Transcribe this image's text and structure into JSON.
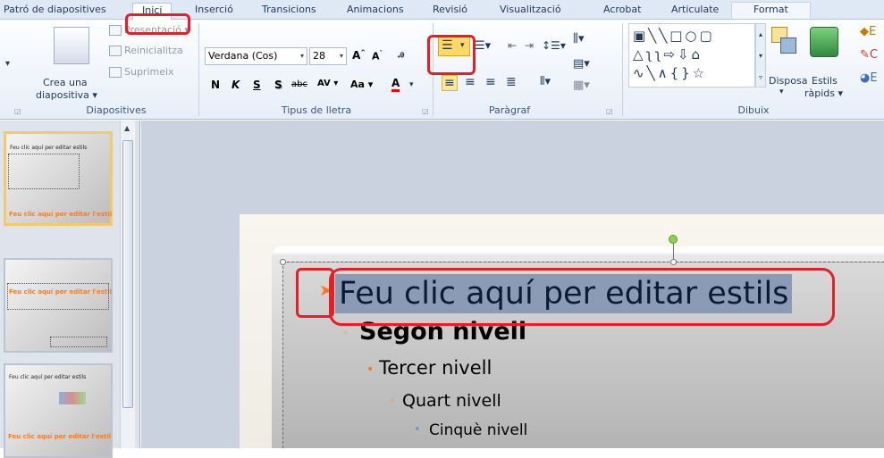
{
  "tabs": [
    {
      "id": "patro",
      "label": "Patró de diapositives"
    },
    {
      "id": "inici",
      "label": "Inici"
    },
    {
      "id": "insercio",
      "label": "Inserció"
    },
    {
      "id": "transicions",
      "label": "Transicions"
    },
    {
      "id": "animacions",
      "label": "Animacions"
    },
    {
      "id": "revisio",
      "label": "Revisió"
    },
    {
      "id": "visualitzacio",
      "label": "Visualització"
    },
    {
      "id": "acrobat",
      "label": "Acrobat"
    },
    {
      "id": "articulate",
      "label": "Articulate"
    },
    {
      "id": "format",
      "label": "Format"
    }
  ],
  "ribbon": {
    "slides_group": {
      "label": "Diapositives",
      "new_slide": "Crea una",
      "new_slide_2": "diapositiva",
      "layout": "Presentació",
      "reset": "Reinicialitza",
      "delete": "Suprimeix"
    },
    "font_group": {
      "label": "Tipus de lletra",
      "font_name": "Verdana (Cos)",
      "font_size": "28",
      "bold": "N",
      "italic": "K",
      "underline": "S",
      "shadow": "S",
      "strike": "abc",
      "spacing": "AV",
      "case": "Aa",
      "color": "A"
    },
    "paragraph_group": {
      "label": "Paràgraf"
    },
    "drawing_group": {
      "label": "Dibuix",
      "arrange": "Disposa",
      "quick_styles": "Estils",
      "quick_styles_2": "ràpids"
    }
  },
  "slide_thumbs": [
    {
      "title": "Feu clic aquí per editar l'estil",
      "top_text": "Feu clic aquí per editar estils"
    },
    {
      "title": "Feu clic aquí per editar l'estil"
    },
    {
      "title": "Feu clic aquí per editar l'estil",
      "top_text": "Feu clic aquí per editar estils"
    }
  ],
  "slide": {
    "level1": "Feu clic aquí per editar estils",
    "level2": "Segon nivell",
    "level3": "Tercer nivell",
    "level4": "Quart nivell",
    "level5": "Cinquè nivell"
  }
}
